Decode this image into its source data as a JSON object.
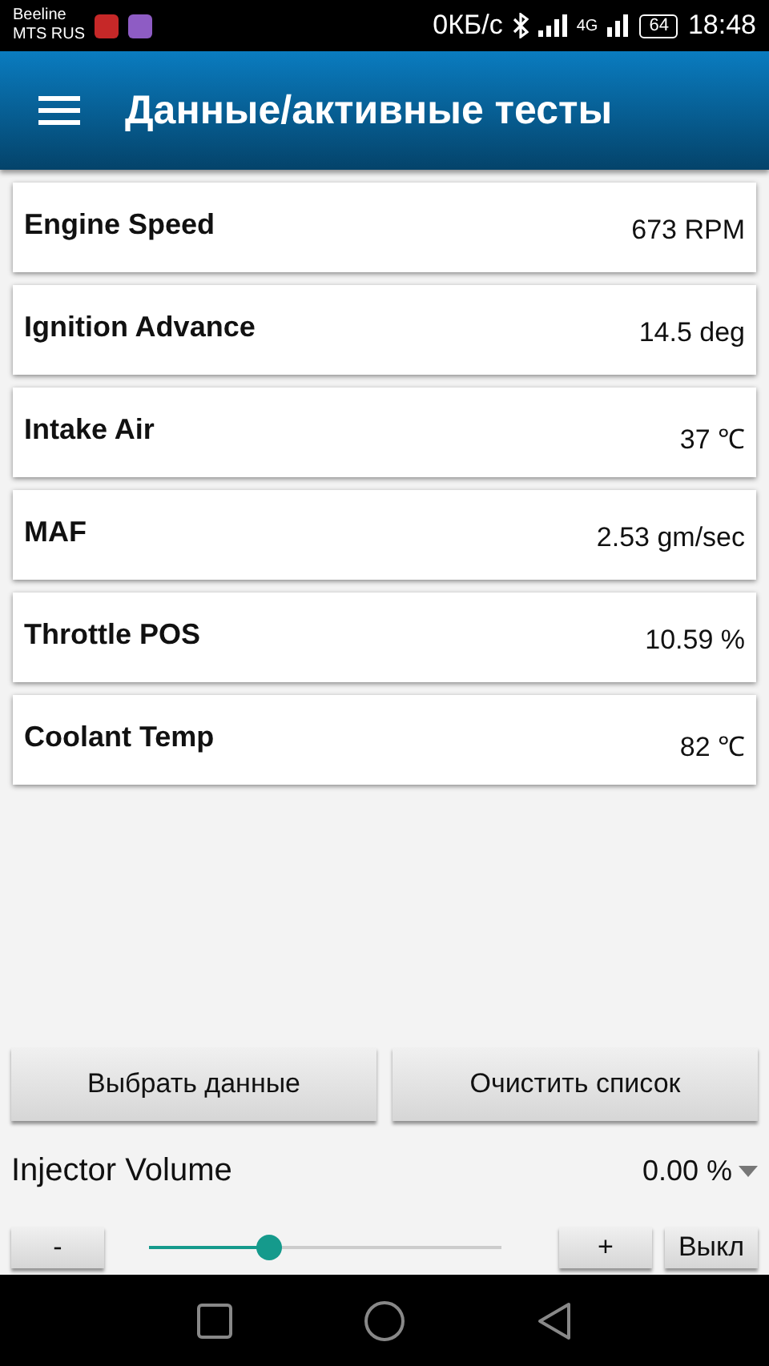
{
  "status_bar": {
    "carrier_1": "Beeline",
    "carrier_2": "MTS RUS",
    "speed": "0КБ/с",
    "network": "4G",
    "battery": "64",
    "time": "18:48"
  },
  "app_bar": {
    "title": "Данные/активные тесты"
  },
  "parameters": [
    {
      "name": "Engine Speed",
      "value": "673 RPM"
    },
    {
      "name": "Ignition Advance",
      "value": "14.5 deg"
    },
    {
      "name": "Intake Air",
      "value": "37 ℃"
    },
    {
      "name": "MAF",
      "value": "2.53 gm/sec"
    },
    {
      "name": "Throttle POS",
      "value": "10.59 %"
    },
    {
      "name": "Coolant Temp",
      "value": "82 ℃"
    }
  ],
  "actions": [
    "Выбрать данные",
    "Очистить список"
  ],
  "active_test": {
    "name": "Injector Volume",
    "value": "0.00 %",
    "level": 0.34,
    "minus": "-",
    "plus": "+",
    "toggle": "Выкл"
  }
}
